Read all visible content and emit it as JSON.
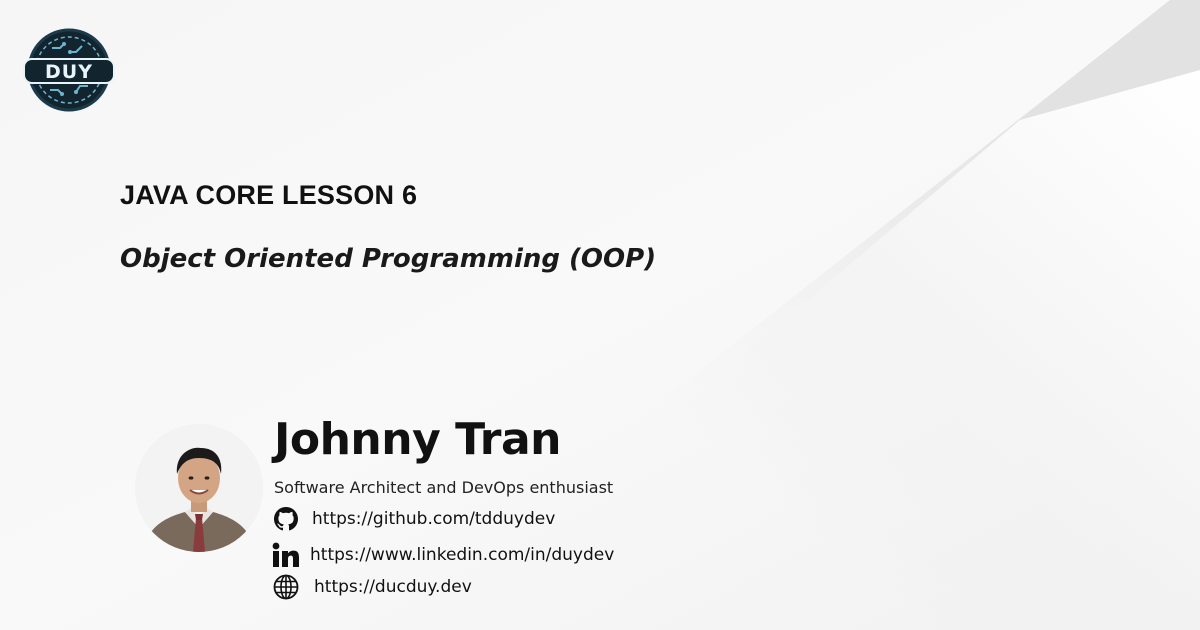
{
  "course": {
    "title": "JAVA CORE LESSON 6",
    "subtitle": "Object Oriented Programming (OOP)"
  },
  "logo": {
    "text": "DUY",
    "icon": "circuit-logo"
  },
  "author": {
    "name": "Johnny Tran",
    "role": "Software Architect and DevOps enthusiast",
    "links": [
      {
        "icon": "github-icon",
        "url": "https://github.com/tdduydev"
      },
      {
        "icon": "linkedin-icon",
        "url": "https://www.linkedin.com/in/duydev"
      },
      {
        "icon": "globe-icon",
        "url": "https://ducduy.dev"
      }
    ]
  },
  "colors": {
    "logo_ring": "#1c3a4a",
    "logo_accent": "#6fb3cf",
    "text": "#111111"
  }
}
